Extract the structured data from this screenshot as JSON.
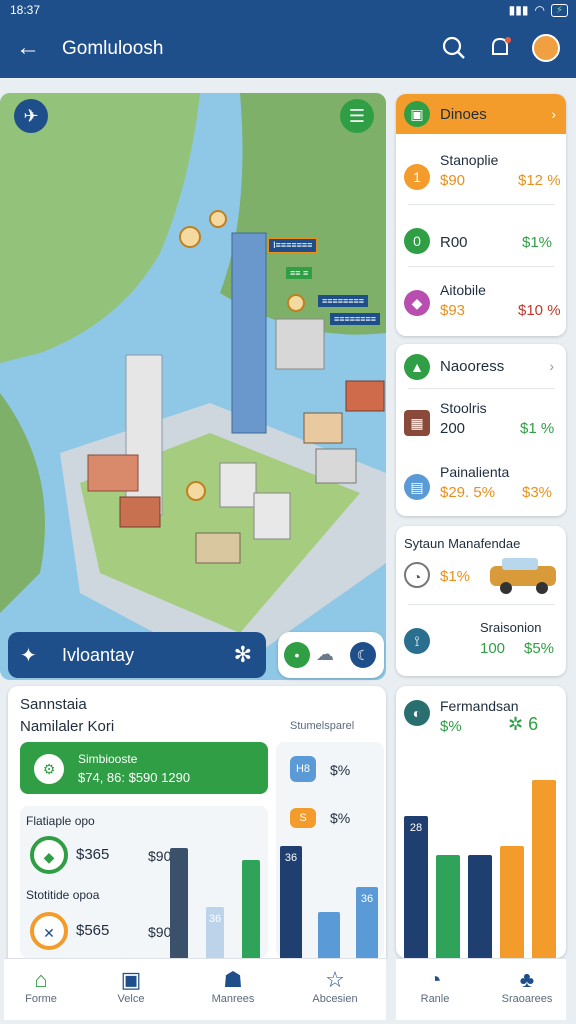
{
  "status": {
    "time": "18:37",
    "battery": "⚡"
  },
  "appbar": {
    "title": "Gomluloosh"
  },
  "map": {
    "labels": [
      {
        "text": "Ⅰ≡≡≡≡≡≡≡"
      },
      {
        "text": "≡≡ ≡"
      },
      {
        "text": "≡≡≡≡≡≡≡≡"
      },
      {
        "text": "≡≡≡≡≡≡≡≡"
      }
    ],
    "bottom_label": "Ivloantay"
  },
  "right_cards": {
    "card1": {
      "header": "Dinoes",
      "rows": [
        {
          "name": "Stanoplie",
          "value": "$90",
          "pct": "$12 %"
        },
        {
          "name": "R00",
          "value": "",
          "pct": "$1%"
        },
        {
          "name": "Aitobile",
          "value": "$93",
          "pct": "$10 %"
        }
      ]
    },
    "card2": {
      "header": "Naooress",
      "rows": [
        {
          "name": "Stoolris",
          "value": "200",
          "pct": "$1 %"
        },
        {
          "name": "Painalienta",
          "value": "$29. 5%",
          "pct": "$3%"
        }
      ]
    },
    "card3": {
      "header": "Sytaun Manafendae",
      "rows": [
        {
          "name": "",
          "value": "$1%",
          "pct": ""
        },
        {
          "name": "Sraisonion",
          "value": "100",
          "pct": "$5%"
        }
      ]
    },
    "card4": {
      "header": "Fermandsan",
      "value": "$%",
      "bars": [
        {
          "value": 0.8,
          "label": "28",
          "color": "#1f3f70"
        },
        {
          "value": 0.58,
          "label": "",
          "color": "#2fa35a"
        },
        {
          "value": 0.58,
          "label": "",
          "color": "#1f3f70"
        },
        {
          "value": 0.63,
          "label": "",
          "color": "#f39b2b"
        },
        {
          "value": 1.0,
          "label": "",
          "color": "#f39b2b"
        }
      ]
    }
  },
  "bottom_panel": {
    "title": "Sannstaia",
    "subtitle": "Namilaler Kori",
    "right_caption": "Stumelsparel",
    "green_box": {
      "title": "Simbiooste",
      "value": "$74, 86: $590 1290"
    },
    "rows": [
      {
        "label": "Flatiaple opo",
        "amount": "$365",
        "amount2": "$90"
      },
      {
        "label": "Stotitide opoa",
        "amount": "$565",
        "amount2": "$90"
      }
    ],
    "right_rows": [
      {
        "icon_text": "H8",
        "value": "$%"
      },
      {
        "icon_text": "S",
        "value": "$%"
      }
    ],
    "bars_left": [
      {
        "value": 0.9,
        "color": "#3a506b"
      },
      {
        "value": 0.42,
        "color": "#bcd3ea",
        "label": "36"
      },
      {
        "value": 0.8,
        "color": "#2fa35a"
      }
    ],
    "bars_right": [
      {
        "value": 0.92,
        "color": "#1f3f70",
        "label": "36"
      },
      {
        "value": 0.38,
        "color": "#5a9ad6"
      },
      {
        "value": 0.58,
        "color": "#5a9ad6",
        "label": "36"
      }
    ]
  },
  "nav": {
    "items": [
      "Forme",
      "Velce",
      "Manrees",
      "Abcesien"
    ],
    "right_items": [
      "Ranle",
      "Sraoarees"
    ]
  }
}
